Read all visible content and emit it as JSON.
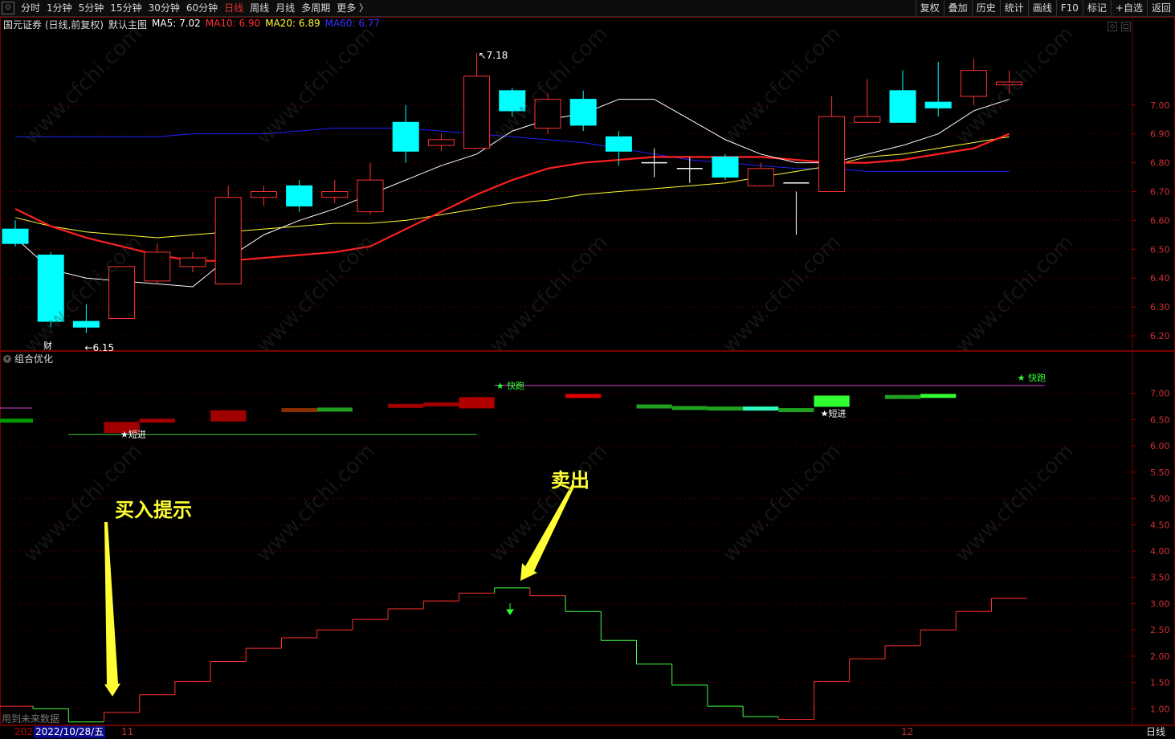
{
  "toolbar": {
    "left": [
      "分时",
      "1分钟",
      "5分钟",
      "15分钟",
      "30分钟",
      "60分钟",
      "日线",
      "周线",
      "月线",
      "多周期",
      "更多 〉"
    ],
    "active": "日线",
    "right": [
      "复权",
      "叠加",
      "历史",
      "统计",
      "画线",
      "F10",
      "标记",
      "+自选",
      "返回"
    ]
  },
  "main": {
    "title": "国元证券 (日线,前复权)",
    "indicator": "默认主图",
    "ma5": "MA5: 7.02",
    "ma10": "MA10: 6.90",
    "ma20": "MA20: 6.89",
    "ma60": "MA60: 6.77",
    "high_label": "7.18",
    "low_label": "6.15",
    "fin_badge": "财",
    "y_ticks": [
      "7.00",
      "6.90",
      "6.80",
      "6.70",
      "6.60",
      "6.50",
      "6.40",
      "6.30",
      "6.20"
    ]
  },
  "sub": {
    "title": "组合优化",
    "labels": [
      "★短进",
      "★ 快跑",
      "★短进",
      "★ 快跑"
    ],
    "y_ticks": [
      "7.00",
      "6.50",
      "6.00",
      "5.50",
      "5.00",
      "4.50",
      "4.00",
      "3.50",
      "3.00",
      "2.50",
      "2.00",
      "1.50",
      "1.00"
    ]
  },
  "annotations": {
    "buy": "买入提示",
    "sell": "卖出"
  },
  "status": {
    "prefix": "2022",
    "date": "2022/10/28/五",
    "tick1": "11",
    "tick2": "12",
    "period": "日线",
    "note": "用到未来数据"
  },
  "colors": {
    "up": "#ff3232",
    "down": "#00ffff",
    "ma5": "#ffffff",
    "ma10": "#ff2020",
    "ma20": "#ffff33",
    "ma60": "#2020ff"
  },
  "chart_data": {
    "type": "candlestick",
    "price": {
      "ylim": [
        6.15,
        7.25
      ],
      "candles": [
        [
          6.57,
          6.52,
          6.6,
          6.51
        ],
        [
          6.48,
          6.25,
          6.49,
          6.23
        ],
        [
          6.25,
          6.23,
          6.31,
          6.21
        ],
        [
          6.26,
          6.44,
          6.44,
          6.26
        ],
        [
          6.39,
          6.49,
          6.52,
          6.38
        ],
        [
          6.44,
          6.47,
          6.49,
          6.42
        ],
        [
          6.38,
          6.68,
          6.72,
          6.38
        ],
        [
          6.68,
          6.7,
          6.72,
          6.65
        ],
        [
          6.72,
          6.65,
          6.74,
          6.63
        ],
        [
          6.68,
          6.7,
          6.74,
          6.66
        ],
        [
          6.63,
          6.74,
          6.8,
          6.62
        ],
        [
          6.94,
          6.84,
          7.0,
          6.8
        ],
        [
          6.86,
          6.88,
          6.9,
          6.84
        ],
        [
          6.85,
          7.1,
          7.18,
          6.85
        ],
        [
          7.05,
          6.98,
          7.06,
          6.96
        ],
        [
          6.92,
          7.02,
          7.04,
          6.9
        ],
        [
          7.02,
          6.93,
          7.05,
          6.91
        ],
        [
          6.89,
          6.84,
          6.91,
          6.79
        ],
        [
          6.8,
          6.8,
          6.85,
          6.75
        ],
        [
          6.78,
          6.78,
          6.82,
          6.73
        ],
        [
          6.82,
          6.75,
          6.83,
          6.74
        ],
        [
          6.72,
          6.78,
          6.8,
          6.72
        ],
        [
          6.73,
          6.73,
          6.7,
          6.55
        ],
        [
          6.7,
          6.96,
          7.03,
          6.7
        ],
        [
          6.94,
          6.96,
          7.09,
          6.94
        ],
        [
          7.05,
          6.94,
          7.12,
          6.94
        ],
        [
          7.01,
          6.99,
          7.15,
          6.96
        ],
        [
          7.03,
          7.12,
          7.16,
          7.0
        ],
        [
          7.07,
          7.08,
          7.12,
          7.04
        ]
      ],
      "ma5": [
        6.54,
        6.43,
        6.4,
        6.39,
        6.38,
        6.37,
        6.47,
        6.55,
        6.6,
        6.64,
        6.69,
        6.74,
        6.79,
        6.83,
        6.91,
        6.95,
        6.97,
        7.02,
        7.02,
        6.95,
        6.88,
        6.83,
        6.8,
        6.8,
        6.83,
        6.86,
        6.9,
        6.98,
        7.02
      ],
      "ma10": [
        6.64,
        6.58,
        6.54,
        6.51,
        6.48,
        6.46,
        6.46,
        6.47,
        6.48,
        6.49,
        6.51,
        6.57,
        6.63,
        6.69,
        6.74,
        6.78,
        6.8,
        6.81,
        6.82,
        6.82,
        6.82,
        6.82,
        6.81,
        6.8,
        6.8,
        6.81,
        6.83,
        6.85,
        6.9
      ],
      "ma20": [
        6.61,
        6.58,
        6.56,
        6.55,
        6.54,
        6.55,
        6.56,
        6.57,
        6.58,
        6.59,
        6.59,
        6.6,
        6.62,
        6.64,
        6.66,
        6.67,
        6.69,
        6.7,
        6.71,
        6.72,
        6.73,
        6.75,
        6.77,
        6.79,
        6.82,
        6.83,
        6.85,
        6.87,
        6.89
      ],
      "ma60": [
        6.89,
        6.89,
        6.89,
        6.89,
        6.89,
        6.9,
        6.9,
        6.9,
        6.91,
        6.92,
        6.92,
        6.92,
        6.91,
        6.9,
        6.89,
        6.88,
        6.87,
        6.85,
        6.83,
        6.81,
        6.8,
        6.79,
        6.78,
        6.78,
        6.77,
        6.77,
        6.77,
        6.77,
        6.77
      ]
    },
    "indicator": {
      "ylim": [
        0.7,
        7.3
      ],
      "step": [
        1.05,
        1.0,
        0.75,
        0.93,
        1.27,
        1.52,
        1.9,
        2.15,
        2.35,
        2.5,
        2.7,
        2.9,
        3.05,
        3.2,
        3.3,
        3.15,
        2.85,
        2.3,
        1.85,
        1.45,
        1.05,
        0.85,
        0.8,
        1.52,
        1.95,
        2.2,
        2.5,
        2.85,
        3.1
      ],
      "rising": [
        true,
        false,
        false,
        true,
        true,
        true,
        true,
        true,
        true,
        true,
        true,
        true,
        true,
        true,
        false,
        true,
        false,
        false,
        false,
        false,
        false,
        false,
        true,
        true,
        true,
        true,
        true,
        true,
        true
      ]
    }
  }
}
